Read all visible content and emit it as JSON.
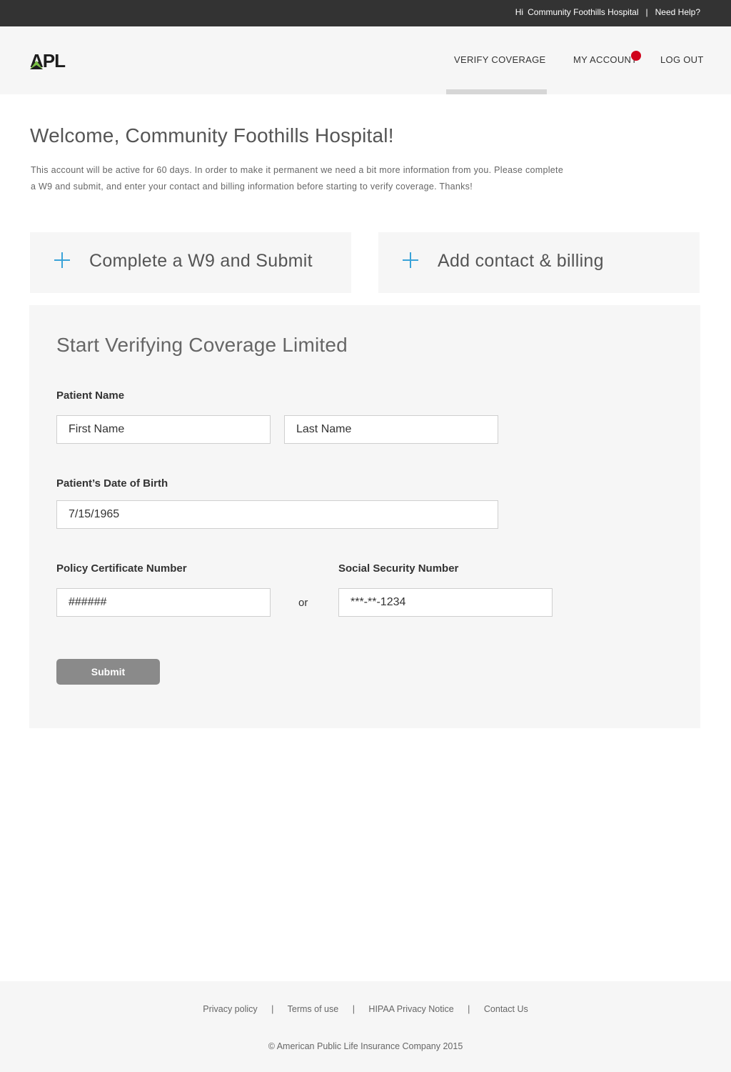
{
  "topbar": {
    "greeting": "Hi",
    "account_name": "Community Foothills Hospital",
    "separator": "|",
    "help_link": "Need Help?"
  },
  "header": {
    "logo_text": "APL",
    "nav": [
      {
        "label": "VERIFY COVERAGE"
      },
      {
        "label": "MY ACCOUNT"
      },
      {
        "label": "LOG OUT"
      }
    ]
  },
  "welcome": {
    "title": "Welcome, Community Foothills Hospital!",
    "line1": "This account will be active for 60 days. In order to make it permanent we need a bit more information from you. Please complete",
    "line2": "a W9 and submit, and enter your contact and billing information before starting to verify coverage. Thanks!"
  },
  "cards": [
    {
      "label": "Complete a W9 and Submit",
      "icon": "plus-icon"
    },
    {
      "label": "Add contact & billing",
      "icon": "plus-icon"
    }
  ],
  "form": {
    "title": "Start Verifying Coverage Limited",
    "patient_name_label": "Patient Name",
    "first_name_placeholder": "First Name",
    "last_name_placeholder": "Last Name",
    "dob_label": "Patient’s Date of Birth",
    "dob_value": "7/15/1965",
    "policy_label": "Policy Certificate Number",
    "policy_value": "######",
    "or_text": "or",
    "ssn_label": "Social Security Number",
    "ssn_value": "***-**-1234",
    "submit_label": "Submit"
  },
  "footer": {
    "links": [
      "Privacy policy",
      "Terms of use",
      "HIPAA Privacy Notice",
      "Contact Us"
    ],
    "separator": "|",
    "copyright": "© American Public Life Insurance Company 2015"
  },
  "colors": {
    "topbar_bg": "#333333",
    "accent_plus": "#3aa3d8",
    "notification": "#d0021b",
    "submit_bg": "#8a8a8a",
    "panel_bg": "#f6f6f6"
  }
}
